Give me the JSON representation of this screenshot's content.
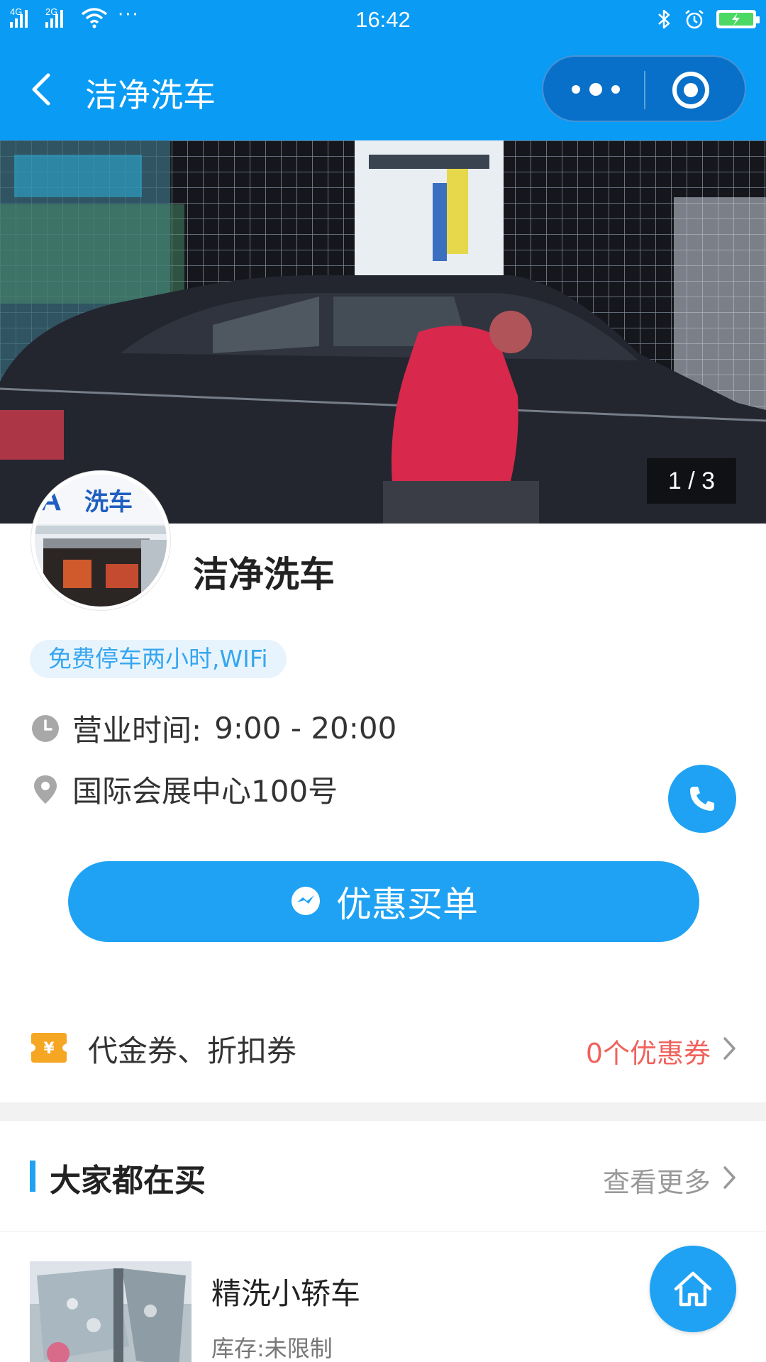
{
  "status_bar": {
    "network_1": "4G",
    "network_2": "2G",
    "dots": "···",
    "time": "16:42"
  },
  "nav": {
    "title": "洁净洗车"
  },
  "banner": {
    "counter": "1 / 3",
    "sign_text": "洗车",
    "avatar_letter": "A"
  },
  "store": {
    "name": "洁净洗车",
    "tag": "免费停车两小时,WIFi",
    "hours_label": "营业时间:",
    "hours_value": "9:00 - 20:00",
    "address": "国际会展中心100号"
  },
  "pay_button": {
    "label": "优惠买单"
  },
  "coupon": {
    "label": "代金券、折扣券",
    "count": "0个优惠券"
  },
  "section": {
    "title": "大家都在买",
    "more": "查看更多"
  },
  "product": {
    "name": "精洗小轿车",
    "stock": "库存:未限制"
  },
  "colors": {
    "primary": "#1fa2f3",
    "header": "#0a9bf4",
    "coupon_red": "#f0625c",
    "tag_bg": "#e8f4fd"
  },
  "icons": [
    "back-icon",
    "more-icon",
    "close-icon",
    "clock-icon",
    "location-icon",
    "phone-icon",
    "message-icon",
    "coupon-icon",
    "chevron-right-icon",
    "home-icon"
  ]
}
